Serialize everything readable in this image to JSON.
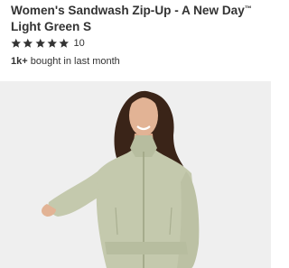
{
  "product": {
    "title_line1": "Women's Sandwash Zip-Up - A New Day",
    "trademark": "™",
    "title_line2": "Light Green S",
    "rating": {
      "stars": 5,
      "max_stars": 5,
      "review_count": "10"
    },
    "purchase": {
      "count": "1k+",
      "text": "bought in last month"
    },
    "image": {
      "icon": "product-photo-icon",
      "garment_color": "#c4c9ad",
      "background_color": "#efefef"
    }
  },
  "colors": {
    "star": "#333333",
    "text": "#333333"
  }
}
